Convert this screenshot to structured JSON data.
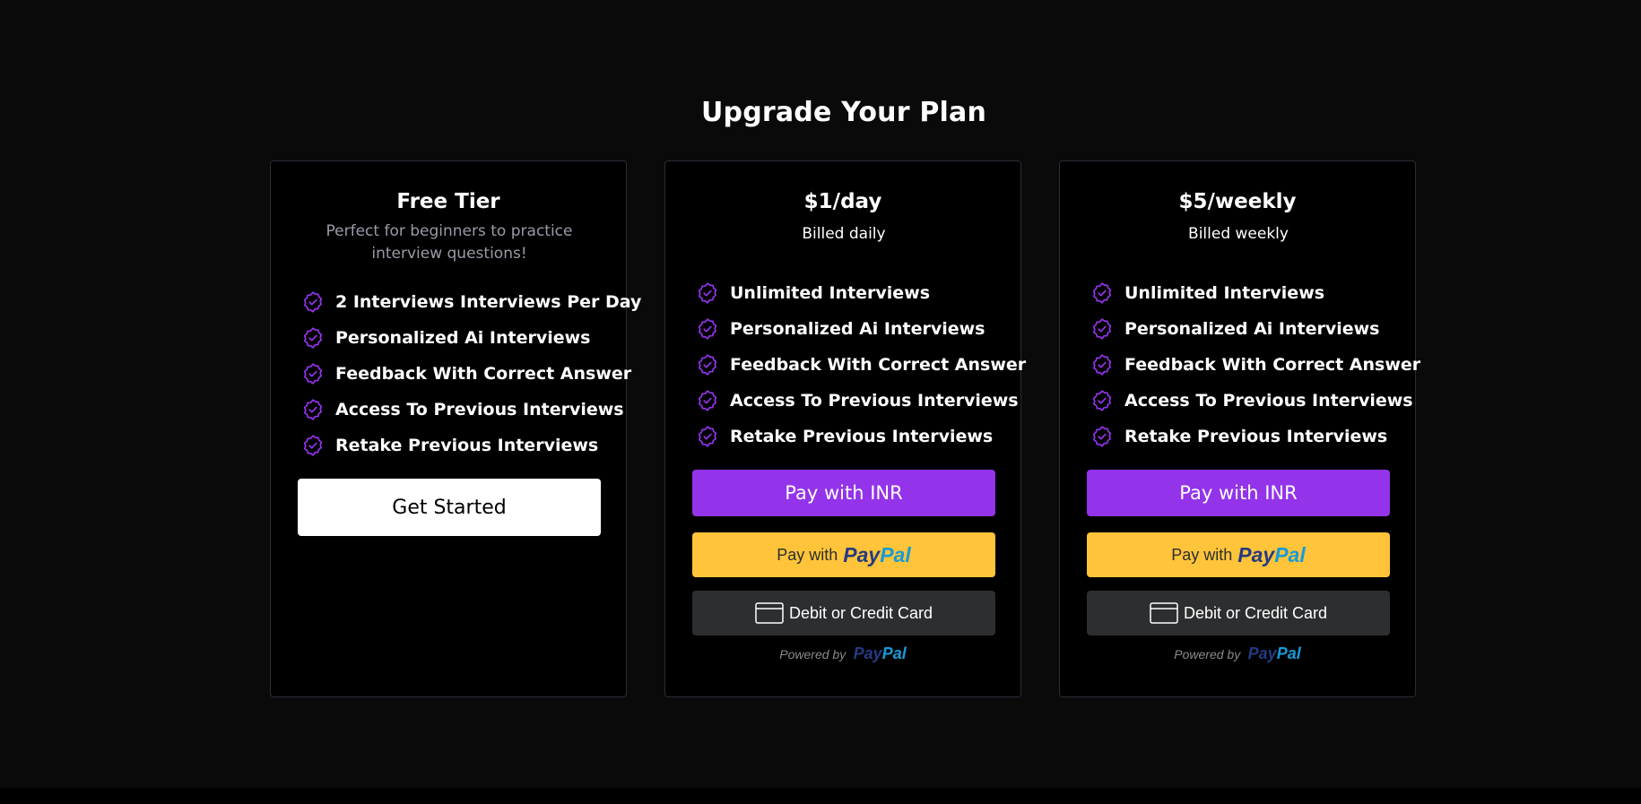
{
  "page": {
    "heading": "Upgrade Your Plan"
  },
  "colors": {
    "background": "#0a0a0b",
    "card_background": "#000000",
    "card_border": "#2b2b38",
    "accent_purple": "#9333ea",
    "paypal_yellow": "#ffc439",
    "paypal_dark_blue": "#253b80",
    "paypal_light_blue": "#179bd7",
    "card_button_gray": "#2c2e30"
  },
  "plans": [
    {
      "title": "Free Tier",
      "subtitle": "Perfect for beginners to practice interview questions!",
      "features": [
        "2 Interviews Interviews Per Day",
        "Personalized Ai Interviews",
        "Feedback With Correct Answer",
        "Access To Previous Interviews",
        "Retake Previous Interviews"
      ],
      "cta_label": "Get Started"
    },
    {
      "title": "$1/day",
      "subtitle": "Billed daily",
      "features": [
        "Unlimited Interviews",
        "Personalized Ai Interviews",
        "Feedback With Correct Answer",
        "Access To Previous Interviews",
        "Retake Previous Interviews"
      ],
      "inr_label": "Pay with INR",
      "paypal_prefix": "Pay with",
      "paypal_brand_1": "Pay",
      "paypal_brand_2": "Pal",
      "card_label": "Debit or Credit Card",
      "powered_by": "Powered by"
    },
    {
      "title": "$5/weekly",
      "subtitle": "Billed weekly",
      "features": [
        "Unlimited Interviews",
        "Personalized Ai Interviews",
        "Feedback With Correct Answer",
        "Access To Previous Interviews",
        "Retake Previous Interviews"
      ],
      "inr_label": "Pay with INR",
      "paypal_prefix": "Pay with",
      "paypal_brand_1": "Pay",
      "paypal_brand_2": "Pal",
      "card_label": "Debit or Credit Card",
      "powered_by": "Powered by"
    }
  ],
  "icons": {
    "feature": "badge-check-icon",
    "card": "credit-card-icon"
  }
}
